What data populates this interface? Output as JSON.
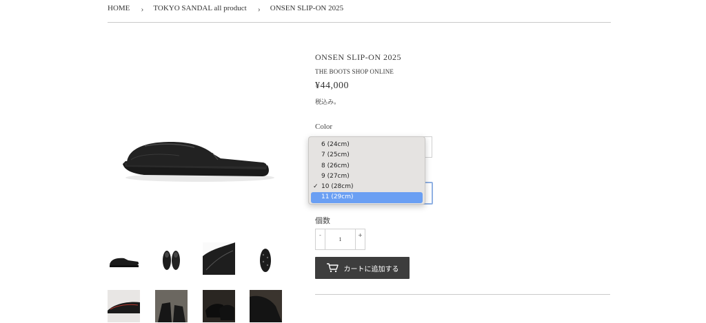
{
  "breadcrumb": {
    "home": "HOME",
    "collection": "TOKYO SANDAL all product",
    "current": "ONSEN SLIP-ON 2025",
    "separator": "›"
  },
  "product": {
    "title": "ONSEN SLIP-ON 2025",
    "vendor": "THE BOOTS SHOP ONLINE",
    "price": "¥44,000",
    "tax_note": "税込み。"
  },
  "options": {
    "color_label": "Color",
    "size_options": [
      "6 (24cm)",
      "7 (25cm)",
      "8 (26cm)",
      "9 (27cm)",
      "10 (28cm)",
      "11 (29cm)"
    ],
    "size_checked": "10 (28cm)",
    "size_highlighted": "11 (29cm)"
  },
  "quantity": {
    "label": "個数",
    "minus": "-",
    "value": "1",
    "plus": "+"
  },
  "cart": {
    "label": "カートに追加する"
  },
  "colors": {
    "button_bg": "#3d3d3d",
    "highlight": "#6a9ff3",
    "focus_border": "#8fb0e3"
  }
}
